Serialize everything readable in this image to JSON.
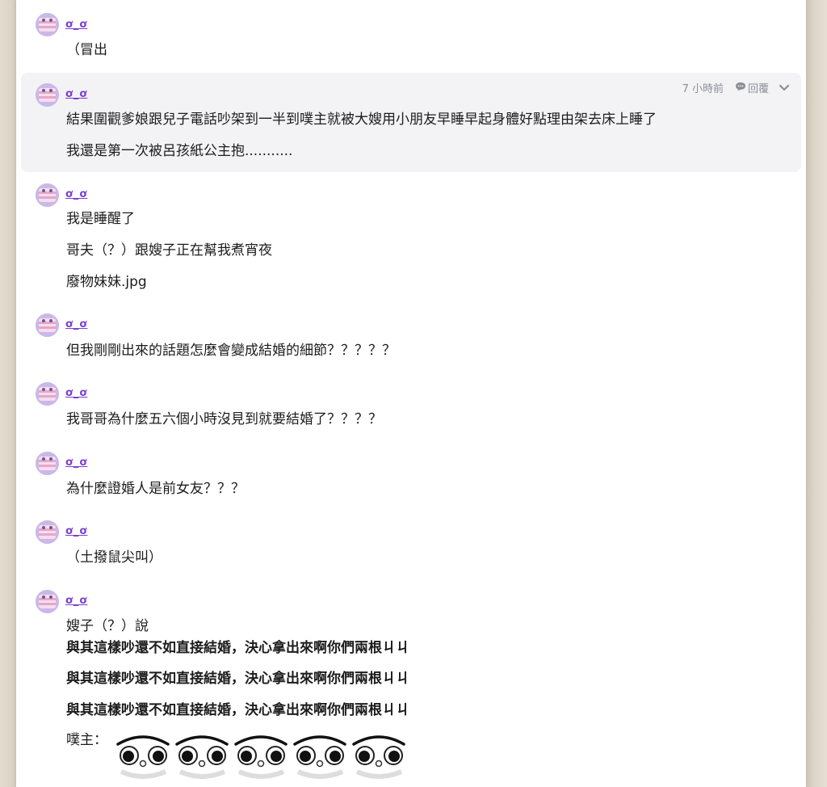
{
  "posts": [
    {
      "user": "ơ_ơ",
      "lines": [
        "（冒出"
      ]
    },
    {
      "user": "ơ_ơ",
      "time": "7 小時前",
      "reply_label": "回覆",
      "lines": [
        "結果圍觀爹娘跟兒子電話吵架到一半到噗主就被大嫂用小朋友早睡早起身體好點理由架去床上睡了",
        "我還是第一次被呂孩紙公主抱..........."
      ]
    },
    {
      "user": "ơ_ơ",
      "lines": [
        "我是睡醒了",
        "哥夫（？）跟嫂子正在幫我煮宵夜",
        "廢物妹妹.jpg"
      ]
    },
    {
      "user": "ơ_ơ",
      "lines": [
        "但我剛剛出來的話題怎麼會變成結婚的細節？？？？？"
      ]
    },
    {
      "user": "ơ_ơ",
      "lines": [
        "我哥哥為什麼五六個小時沒見到就要結婚了？？？？"
      ]
    },
    {
      "user": "ơ_ơ",
      "lines": [
        "為什麼證婚人是前女友？？？"
      ]
    },
    {
      "user": "ơ_ơ",
      "lines": [
        "（土撥鼠尖叫）"
      ]
    },
    {
      "user": "ơ_ơ",
      "lines": [
        "嫂子（？）說",
        "與其這樣吵還不如直接結婚，決心拿出來啊你們兩根ㄐㄐ",
        "與其這樣吵還不如直接結婚，決心拿出來啊你們兩根ㄐㄐ",
        "與其這樣吵還不如直接結婚，決心拿出來啊你們兩根ㄐㄐ",
        "噗主："
      ],
      "stickers": [
        "staring-eyes-emoticon",
        "staring-eyes-emoticon",
        "staring-eyes-emoticon",
        "staring-eyes-emoticon",
        "staring-eyes-emoticon"
      ]
    }
  ],
  "colors": {
    "username": "#7b3fd2",
    "highlight": "#f3f3f5",
    "meta": "#8a8f9a",
    "background": "#e8e2d8"
  },
  "icons": {
    "reply": "speech-bubble-icon",
    "expand": "chevron-down-icon"
  }
}
